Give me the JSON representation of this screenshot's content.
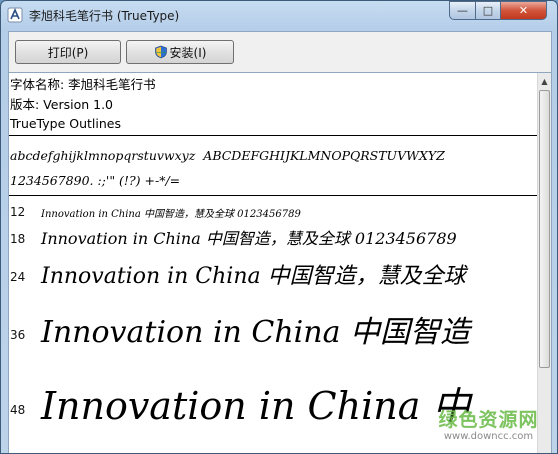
{
  "window": {
    "title": "李旭科毛笔行书 (TrueType)",
    "controls": {
      "minimize": "—",
      "maximize": "□",
      "close": "✕"
    }
  },
  "toolbar": {
    "print_label": "打印(P)",
    "install_label": "安装(I)"
  },
  "font_info": {
    "name_line": "字体名称: 李旭科毛笔行书",
    "version_line": "版本: Version 1.0",
    "format_line": "TrueType Outlines"
  },
  "specimen": {
    "lowercase": "abcdefghijklmnopqrstuvwxyz",
    "uppercase": "ABCDEFGHIJKLMNOPQRSTUVWXYZ",
    "digits_symbols": "1234567890. :;'\" (!?) +-*/="
  },
  "size_samples": [
    {
      "size": "12",
      "text": "Innovation in China 中国智造，慧及全球 0123456789"
    },
    {
      "size": "18",
      "text": "Innovation in China 中国智造，慧及全球 0123456789"
    },
    {
      "size": "24",
      "text": "Innovation in China 中国智造，慧及全球"
    },
    {
      "size": "36",
      "text": "Innovation in China 中国智造"
    },
    {
      "size": "48",
      "text": "Innovation in China 中"
    }
  ],
  "watermark": {
    "brand": "绿色资源网",
    "url": "www.downcc.com"
  },
  "colors": {
    "title_bar": "#b9d1ea",
    "close_button": "#c7452c",
    "watermark_green": "#6fbd4f"
  }
}
